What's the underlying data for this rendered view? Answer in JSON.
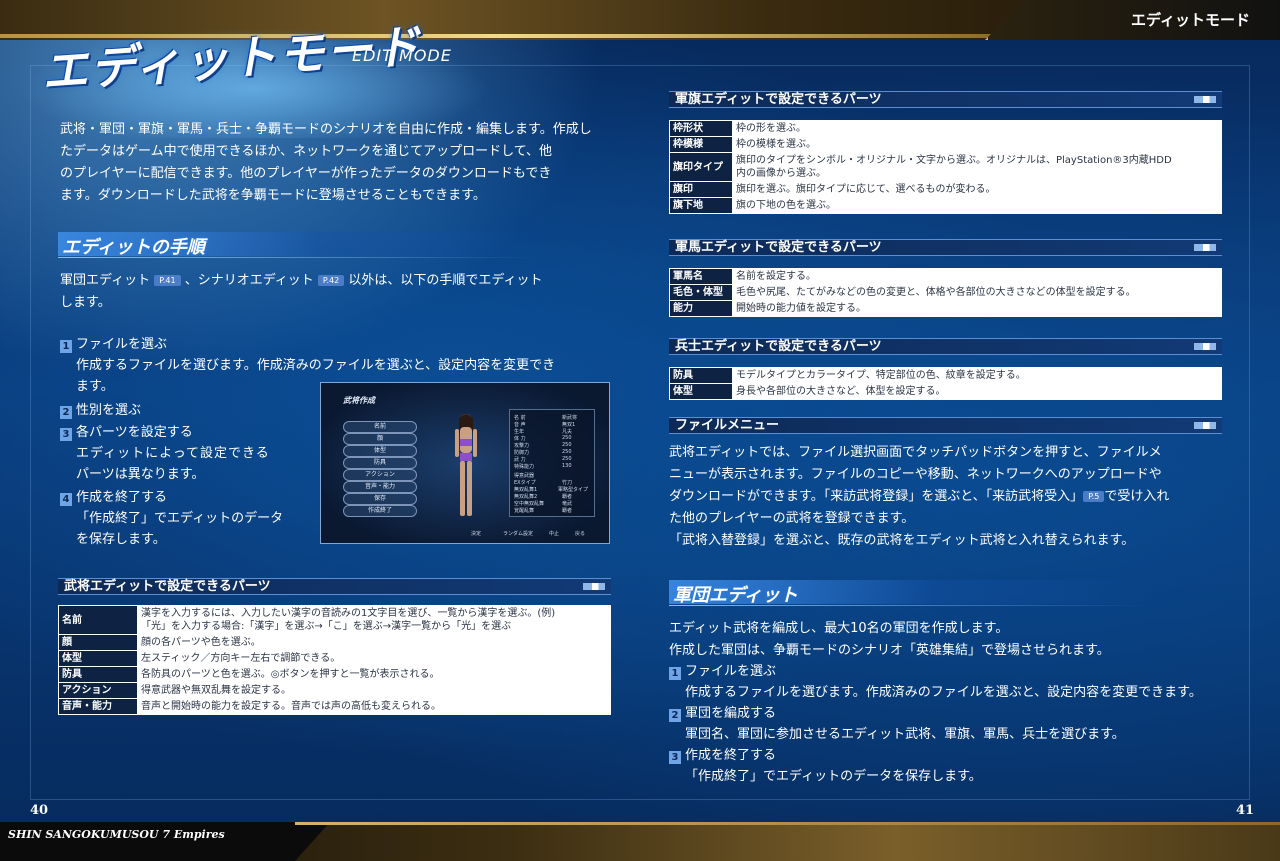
{
  "header": {
    "section_title": "エディットモード"
  },
  "footer": {
    "game_title": "SHIN SANGOKUMUSOU 7 Empires",
    "page_left": "40",
    "page_right": "41"
  },
  "hero": {
    "title": "エディットモード",
    "subtitle": "EDIT MODE"
  },
  "intro": {
    "lines": [
      "武将・軍団・軍旗・軍馬・兵士・争覇モードのシナリオを自由に作成・編集します。作成し",
      "たデータはゲーム中で使用できるほか、ネットワークを通じてアップロードして、他",
      "のプレイヤーに配信できます。他のプレイヤーが作ったデータのダウンロードもでき",
      "ます。ダウンロードした武将を争覇モードに登場させることもできます。"
    ]
  },
  "procedure": {
    "heading": "エディットの手順",
    "intro_a": "軍団エディット",
    "ref_a": "P.41",
    "intro_b": "、シナリオエディット",
    "ref_b": "P.42",
    "intro_c": "以外は、以下の手順でエディット",
    "intro_d": "します。",
    "steps": [
      {
        "n": "1",
        "title": "ファイルを選ぶ"
      },
      {
        "n": "2",
        "title": "性別を選ぶ"
      },
      {
        "n": "3",
        "title": "各パーツを設定する"
      },
      {
        "n": "4",
        "title": "作成を終了する"
      }
    ],
    "step1_desc_1": "作成するファイルを選びます。作成済みのファイルを選ぶと、設定内容を変更でき",
    "step1_desc_2": "ます。",
    "step3_desc_1": "エディットによって設定できる",
    "step3_desc_2": "パーツは異なります。",
    "step4_desc_1": "「作成終了」でエディットのデータ",
    "step4_desc_2": "を保存します。"
  },
  "screenshot": {
    "title": "武将作成",
    "menu": [
      "名前",
      "顔",
      "体型",
      "防具",
      "アクション",
      "音声・能力",
      "保存",
      "作成終了"
    ],
    "stats": [
      [
        "名 前",
        "新武将"
      ],
      [
        "音 声",
        "無双1"
      ],
      [
        "生年",
        "凡夫"
      ],
      [
        "体 力",
        "250"
      ],
      [
        "攻撃力",
        "250"
      ],
      [
        "防御力",
        "250"
      ],
      [
        "武 力",
        "250"
      ],
      [
        "特殊能力",
        "130"
      ],
      [
        "得意武器",
        ""
      ],
      [
        "EXタイプ",
        "竹刀"
      ],
      [
        "無双乱舞1",
        "軍略型タイプ"
      ],
      [
        "無双乱舞2",
        "覇者"
      ],
      [
        "空中無双乱舞",
        "竜武"
      ],
      [
        "覚醒乱舞",
        "覇者"
      ]
    ],
    "hints": [
      "決定",
      "ランダム設定",
      "中止",
      "戻る"
    ]
  },
  "busho_parts": {
    "heading": "武将エディットで設定できるパーツ",
    "rows": [
      {
        "k": "名前",
        "v1": "漢字を入力するには、入力したい漢字の音読みの1文字目を選び、一覧から漢字を選ぶ。(例)",
        "v2": "「光」を入力する場合:「漢字」を選ぶ→「こ」を選ぶ→漢字一覧から「光」を選ぶ"
      },
      {
        "k": "顔",
        "v1": "顔の各パーツや色を選ぶ。"
      },
      {
        "k": "体型",
        "v1": "左スティック／方向キー左右で調節できる。"
      },
      {
        "k": "防具",
        "v1": "各防具のパーツと色を選ぶ。◎ボタンを押すと一覧が表示される。"
      },
      {
        "k": "アクション",
        "v1": "得意武器や無双乱舞を設定する。"
      },
      {
        "k": "音声・能力",
        "v1": "音声と開始時の能力を設定する。音声では声の高低も変えられる。"
      }
    ]
  },
  "flag_parts": {
    "heading": "軍旗エディットで設定できるパーツ",
    "rows": [
      {
        "k": "枠形状",
        "v1": "枠の形を選ぶ。"
      },
      {
        "k": "枠模様",
        "v1": "枠の模様を選ぶ。"
      },
      {
        "k": "旗印タイプ",
        "v1": "旗印のタイプをシンボル・オリジナル・文字から選ぶ。オリジナルは、PlayStation®3内蔵HDD",
        "v2": "内の画像から選ぶ。"
      },
      {
        "k": "旗印",
        "v1": "旗印を選ぶ。旗印タイプに応じて、選べるものが変わる。"
      },
      {
        "k": "旗下地",
        "v1": "旗の下地の色を選ぶ。"
      }
    ]
  },
  "horse_parts": {
    "heading": "軍馬エディットで設定できるパーツ",
    "rows": [
      {
        "k": "軍馬名",
        "v1": "名前を設定する。"
      },
      {
        "k": "毛色・体型",
        "v1": "毛色や尻尾、たてがみなどの色の変更と、体格や各部位の大きさなどの体型を設定する。"
      },
      {
        "k": "能力",
        "v1": "開始時の能力値を設定する。"
      }
    ]
  },
  "soldier_parts": {
    "heading": "兵士エディットで設定できるパーツ",
    "rows": [
      {
        "k": "防具",
        "v1": "モデルタイプとカラータイプ、特定部位の色、紋章を設定する。"
      },
      {
        "k": "体型",
        "v1": "身長や各部位の大きさなど、体型を設定する。"
      }
    ]
  },
  "file_menu": {
    "heading": "ファイルメニュー",
    "line1": "武将エディットでは、ファイル選択画面でタッチパッドボタンを押すと、ファイルメ",
    "line2": "ニューが表示されます。ファイルのコピーや移動、ネットワークへのアップロードや",
    "line3": "ダウンロードができます。「来訪武将登録」を選ぶと、「来訪武将受入」",
    "ref": "P.5",
    "line3b": "で受け入れ",
    "line4": "た他のプレイヤーの武将を登録できます。",
    "line5": "「武将入替登録」を選ぶと、既存の武将をエディット武将と入れ替えられます。"
  },
  "army_edit": {
    "heading": "軍団エディット",
    "line1": "エディット武将を編成し、最大10名の軍団を作成します。",
    "line2": "作成した軍団は、争覇モードのシナリオ「英雄集結」で登場させられます。",
    "steps": [
      {
        "n": "1",
        "title": "ファイルを選ぶ",
        "desc": "作成するファイルを選びます。作成済みのファイルを選ぶと、設定内容を変更できます。"
      },
      {
        "n": "2",
        "title": "軍団を編成する",
        "desc": "軍団名、軍団に参加させるエディット武将、軍旗、軍馬、兵士を選びます。"
      },
      {
        "n": "3",
        "title": "作成を終了する",
        "desc": "「作成終了」でエディットのデータを保存します。"
      }
    ]
  }
}
